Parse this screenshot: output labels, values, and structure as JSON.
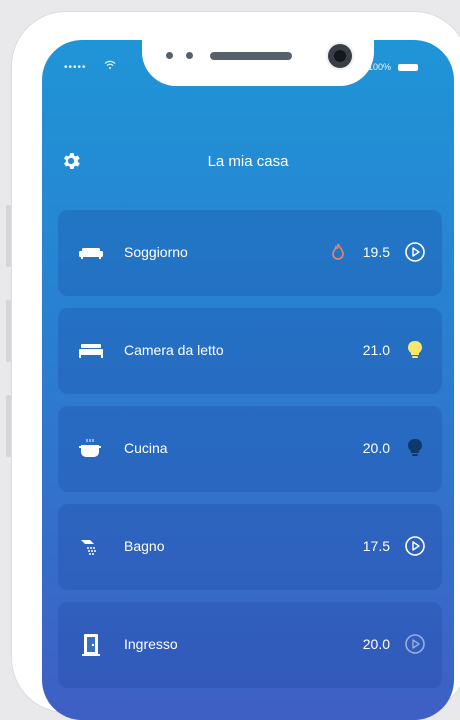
{
  "status_bar": {
    "signal": "•••••",
    "battery": "100%"
  },
  "header": {
    "title": "La mia casa"
  },
  "rooms": [
    {
      "name": "Soggiorno",
      "temperature": "19.5",
      "icon": "sofa-icon",
      "status_icon": "play-circle-icon",
      "heating": true
    },
    {
      "name": "Camera da letto",
      "temperature": "21.0",
      "icon": "bed-icon",
      "status_icon": "lightbulb-on-icon",
      "heating": false
    },
    {
      "name": "Cucina",
      "temperature": "20.0",
      "icon": "pot-icon",
      "status_icon": "lightbulb-off-icon",
      "heating": false
    },
    {
      "name": "Bagno",
      "temperature": "17.5",
      "icon": "shower-icon",
      "status_icon": "play-circle-icon",
      "heating": false
    },
    {
      "name": "Ingresso",
      "temperature": "20.0",
      "icon": "door-icon",
      "status_icon": "play-circle-icon",
      "heating": false
    }
  ],
  "colors": {
    "background_top": "#1f95d6",
    "background_bottom": "#3f5fc4",
    "bulb_on": "#f5e86a",
    "bulb_off": "#0d3a6b",
    "flame": "#e8846e"
  }
}
